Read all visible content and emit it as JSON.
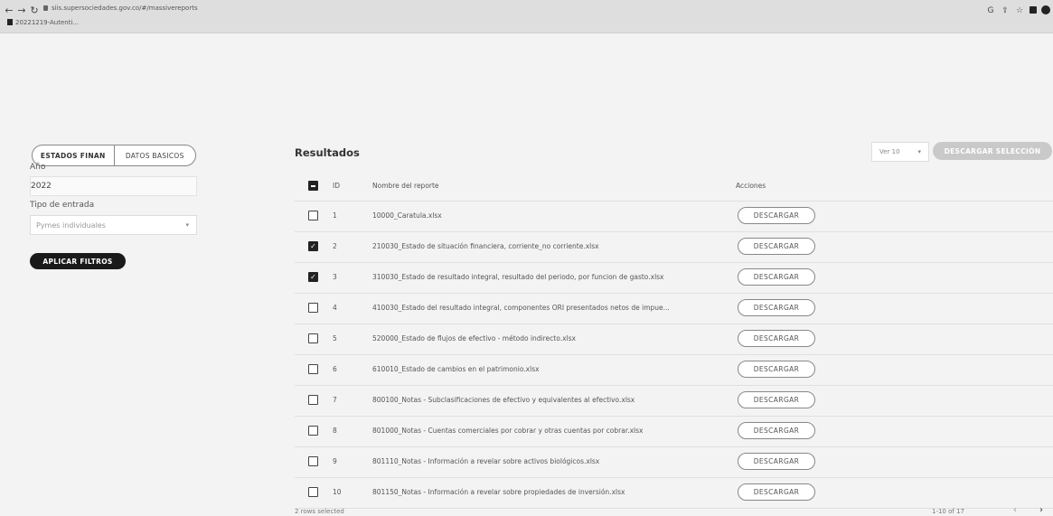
{
  "browser": {
    "url": "siis.supersociedades.gov.co/#/massivereports",
    "bookmark": "20221219-Autenti...",
    "icons": [
      "back-arrow",
      "forward-arrow",
      "reload",
      "google-icon",
      "share-icon",
      "star-icon",
      "extension-icon",
      "profile-icon"
    ]
  },
  "filters": {
    "tabs": [
      "ESTADOS FINAN",
      "DATOS BASICOS"
    ],
    "year_label": "Año",
    "year_value": "2022",
    "entry_type_label": "Tipo de entrada",
    "entry_type_value": "Pymes individuales",
    "apply_button": "APLICAR FILTROS"
  },
  "results": {
    "title": "Resultados",
    "per_page": "Ver 10",
    "download_selection": "DESCARGAR SELECCIÓN",
    "columns": [
      "ID",
      "Nombre del reporte",
      "Acciones"
    ],
    "action_label": "DESCARGAR",
    "rows": [
      {
        "id": "1",
        "name": "10000_Caratula.xlsx",
        "checked": false
      },
      {
        "id": "2",
        "name": "210030_Estado de situación financiera, corriente_no corriente.xlsx",
        "checked": true
      },
      {
        "id": "3",
        "name": "310030_Estado de resultado integral, resultado del periodo, por funcion de gasto.xlsx",
        "checked": true
      },
      {
        "id": "4",
        "name": "410030_Estado del resultado integral, componentes ORI presentados netos de impue...",
        "checked": false
      },
      {
        "id": "5",
        "name": "520000_Estado de flujos de efectivo - método indirecto.xlsx",
        "checked": false
      },
      {
        "id": "6",
        "name": "610010_Estado de cambios en el patrimonio.xlsx",
        "checked": false
      },
      {
        "id": "7",
        "name": "800100_Notas - Subclasificaciones de efectivo y equivalentes al efectivo.xlsx",
        "checked": false
      },
      {
        "id": "8",
        "name": "801000_Notas - Cuentas comerciales por cobrar y otras cuentas por cobrar.xlsx",
        "checked": false
      },
      {
        "id": "9",
        "name": "801110_Notas - Información a revelar sobre activos biológicos.xlsx",
        "checked": false
      },
      {
        "id": "10",
        "name": "801150_Notas - Información a revelar sobre propiedades de inversión.xlsx",
        "checked": false
      }
    ],
    "selected_text": "2 rows selected",
    "pagination_text": "1-10 of 17"
  }
}
